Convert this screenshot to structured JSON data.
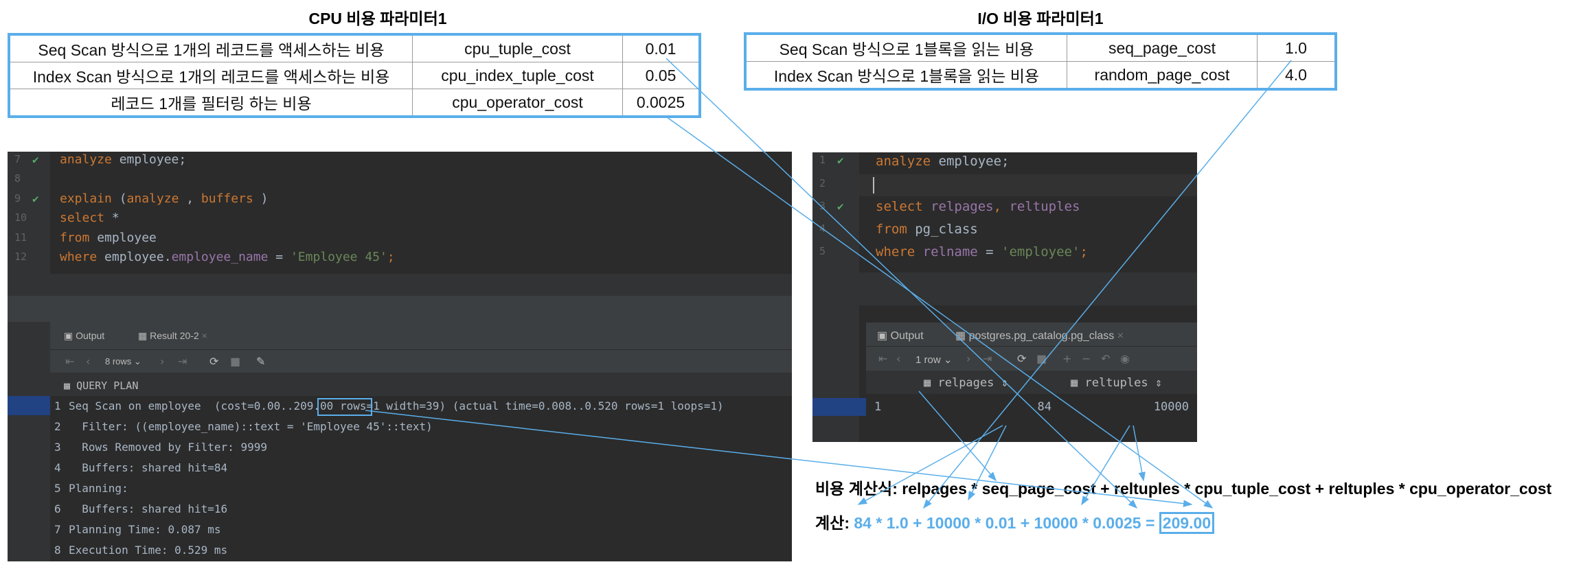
{
  "cpu_params": {
    "title": "CPU 비용 파라미터1",
    "rows": [
      {
        "desc": "Seq Scan 방식으로 1개의 레코드를 액세스하는 비용",
        "name": "cpu_tuple_cost",
        "value": "0.01"
      },
      {
        "desc": "Index Scan 방식으로 1개의 레코드를 액세스하는 비용",
        "name": "cpu_index_tuple_cost",
        "value": "0.05"
      },
      {
        "desc": "레코드 1개를 필터링 하는 비용",
        "name": "cpu_operator_cost",
        "value": "0.0025"
      }
    ]
  },
  "io_params": {
    "title": "I/O 비용 파라미터1",
    "rows": [
      {
        "desc": "Seq Scan 방식으로 1블록을 읽는 비용",
        "name": "seq_page_cost",
        "value": "1.0"
      },
      {
        "desc": "Index Scan 방식으로 1블록을 읽는 비용",
        "name": "random_page_cost",
        "value": "4.0"
      }
    ]
  },
  "left_editor": {
    "line_numbers": [
      "7",
      "8",
      "9",
      "10",
      "11",
      "12"
    ],
    "lines": {
      "l7": {
        "kw": "analyze",
        "rest": " employee;"
      },
      "l9": {
        "kw1": "explain",
        "p1": " (",
        "kw2": "analyze",
        "p2": " , ",
        "kw3": "buffers",
        "p3": " )"
      },
      "l10": {
        "kw": "select",
        "rest": " *"
      },
      "l11": {
        "kw": "from",
        "rest": " employee"
      },
      "l12": {
        "kw": "where",
        "t1": " employee.",
        "col": "employee_name",
        "t2": " = ",
        "str": "'Employee 45'",
        "end": ";"
      }
    },
    "tabs": {
      "output": "Output",
      "result": "Result 20-2"
    },
    "rows_selector": "8 rows",
    "column_header": "QUERY PLAN",
    "plan": [
      {
        "num": "1",
        "text": "Seq Scan on employee  (cost=0.00..209.00 rows=1 width=39) (actual time=0.008..0.520 rows=1 loops=1)"
      },
      {
        "num": "2",
        "text": "  Filter: ((employee_name)::text = 'Employee 45'::text)"
      },
      {
        "num": "3",
        "text": "  Rows Removed by Filter: 9999"
      },
      {
        "num": "4",
        "text": "  Buffers: shared hit=84"
      },
      {
        "num": "5",
        "text": "Planning:"
      },
      {
        "num": "6",
        "text": "  Buffers: shared hit=16"
      },
      {
        "num": "7",
        "text": "Planning Time: 0.087 ms"
      },
      {
        "num": "8",
        "text": "Execution Time: 0.529 ms"
      }
    ]
  },
  "right_editor": {
    "line_numbers": [
      "1",
      "2",
      "3",
      "4",
      "5"
    ],
    "lines": {
      "l1": {
        "kw": "analyze",
        "rest": " employee;"
      },
      "l3": {
        "kw": "select",
        "c1": " relpages",
        "sep": ",",
        "c2": " reltuples"
      },
      "l4": {
        "kw": "from",
        "rest": " pg_class"
      },
      "l5": {
        "kw": "where",
        "col": " relname",
        "eq": " = ",
        "str": "'employee'",
        "end": ";"
      }
    },
    "tabs": {
      "output": "Output",
      "result": "postgres.pg_catalog.pg_class"
    },
    "rows_selector": "1 row",
    "columns": [
      "relpages",
      "reltuples"
    ],
    "row": {
      "num": "1",
      "relpages": "84",
      "reltuples": "10000"
    }
  },
  "formula": {
    "label": "비용 계산식:",
    "expr": "relpages * seq_page_cost + reltuples * cpu_tuple_cost + reltuples * cpu_operator_cost",
    "calc_label": "계산:",
    "calc_expr": "84 * 1.0 + 10000 * 0.01 + 10000 * 0.0025",
    "calc_eq": "=",
    "calc_result": "209.00"
  },
  "colors": {
    "accent": "#5aaeea",
    "ide_bg": "#2b2b2b",
    "keyword": "#cc7832",
    "identifier": "#9876aa",
    "string": "#6a8759"
  },
  "icons": [
    "check-icon",
    "output-icon",
    "table-icon",
    "refresh-icon",
    "stop-icon",
    "pin-icon",
    "sort-icon"
  ]
}
